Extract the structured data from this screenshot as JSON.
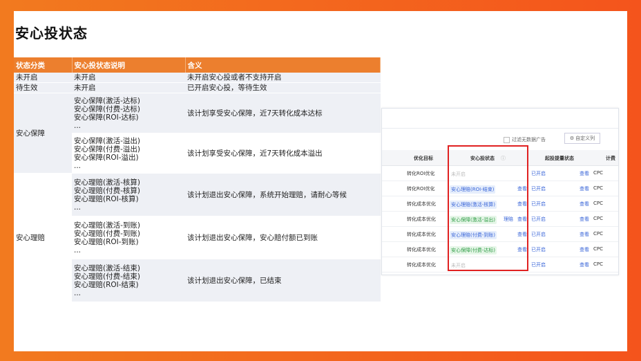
{
  "title": "安心投状态",
  "table": {
    "headers": [
      "状态分类",
      "安心投状态说明",
      "含义"
    ],
    "rows": [
      {
        "category": "未开启",
        "desc": [
          "未开启"
        ],
        "meaning": "未开启安心投或者不支持开启"
      },
      {
        "category": "待生效",
        "desc": [
          "未开启"
        ],
        "meaning": "已开启安心投，等待生效"
      },
      {
        "category": "安心保障",
        "desc": [
          "安心保障(激活-达标)",
          "安心保障(付费-达标)",
          "安心保障(ROI-达标)",
          "..."
        ],
        "meaning": "该计划享受安心保障，近7天转化成本达标"
      },
      {
        "category": "",
        "desc": [
          "安心保障(激活-溢出)",
          "安心保障(付费-溢出)",
          "安心保障(ROI-溢出)",
          "..."
        ],
        "meaning": "该计划享受安心保障，近7天转化成本溢出"
      },
      {
        "category": "安心理赔",
        "desc": [
          "安心理赔(激活-核算)",
          "安心理赔(付费-核算)",
          "安心理赔(ROI-核算)",
          "..."
        ],
        "meaning": "该计划退出安心保障，系统开始理赔，请耐心等候"
      },
      {
        "category": "",
        "desc": [
          "安心理赔(激活-到账)",
          "安心理赔(付费-到账)",
          "安心理赔(ROI-到账)",
          "..."
        ],
        "meaning": "该计划退出安心保障，安心赔付额已到账"
      },
      {
        "category": "",
        "desc": [
          "安心理赔(激活-结束)",
          "安心理赔(付费-结束)",
          "安心理赔(ROI-结束)",
          "..."
        ],
        "meaning": "该计划退出安心保障，已结束"
      }
    ]
  },
  "screenshot": {
    "filter_label": "过滤无数据广告",
    "column_button": "自定义列",
    "headers": {
      "goal": "优化目标",
      "status": "安心投状态",
      "boost": "起投提量状态",
      "bid": "计费"
    },
    "rows": [
      {
        "goal": "转化ROI优化",
        "status": "未开启",
        "status_style": "grey",
        "view": "",
        "claim": "",
        "boost": "已开启",
        "boost_view": "查看",
        "bid": "CPC"
      },
      {
        "goal": "转化ROI优化",
        "status": "安心理赔(ROI-结束)",
        "status_style": "blue",
        "view": "查看",
        "claim": "",
        "boost": "已开启",
        "boost_view": "查看",
        "bid": "CPC"
      },
      {
        "goal": "转化成本优化",
        "status": "安心理赔(激活-核算)",
        "status_style": "blue",
        "view": "查看",
        "claim": "",
        "boost": "已开启",
        "boost_view": "查看",
        "bid": "CPC"
      },
      {
        "goal": "转化成本优化",
        "status": "安心保障(激活-溢出)",
        "status_style": "green",
        "view": "查看",
        "claim": "理赔",
        "boost": "已开启",
        "boost_view": "查看",
        "bid": "CPC"
      },
      {
        "goal": "转化成本优化",
        "status": "安心理赔(付费-到账)",
        "status_style": "blue",
        "view": "查看",
        "claim": "",
        "boost": "已开启",
        "boost_view": "查看",
        "bid": "CPC"
      },
      {
        "goal": "转化成本优化",
        "status": "安心保障(付费-达标)",
        "status_style": "green",
        "view": "查看",
        "claim": "",
        "boost": "已开启",
        "boost_view": "查看",
        "bid": "CPC"
      },
      {
        "goal": "转化成本优化",
        "status": "未开启",
        "status_style": "grey",
        "view": "",
        "claim": "",
        "boost": "已开启",
        "boost_view": "查看",
        "bid": "CPC"
      }
    ]
  },
  "colors": {
    "accent": "#ec7f2e",
    "band": "#eef0f5",
    "highlight": "#e02020"
  }
}
